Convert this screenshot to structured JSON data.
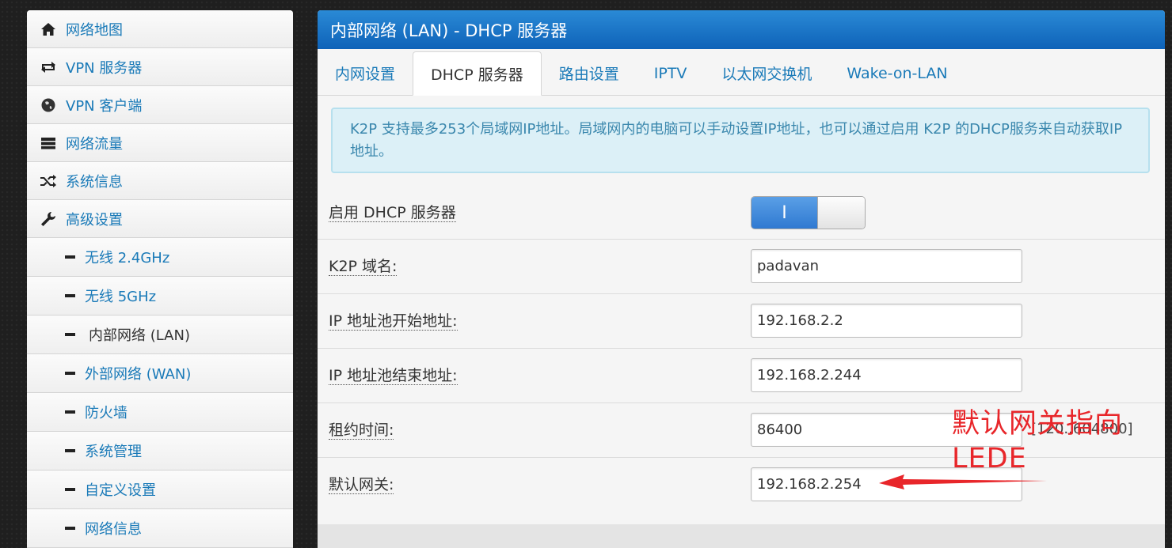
{
  "sidebar": {
    "items": [
      {
        "label": "网络地图",
        "icon": "home-icon"
      },
      {
        "label": "VPN 服务器",
        "icon": "retweet-icon"
      },
      {
        "label": "VPN 客户端",
        "icon": "globe-icon"
      },
      {
        "label": "网络流量",
        "icon": "tasks-icon"
      },
      {
        "label": "系统信息",
        "icon": "random-icon"
      },
      {
        "label": "高级设置",
        "icon": "wrench-icon"
      }
    ],
    "subitems": [
      {
        "label": "无线 2.4GHz"
      },
      {
        "label": "无线 5GHz"
      },
      {
        "label": "内部网络 (LAN)",
        "active": true
      },
      {
        "label": "外部网络 (WAN)"
      },
      {
        "label": "防火墙"
      },
      {
        "label": "系统管理"
      },
      {
        "label": "自定义设置"
      },
      {
        "label": "网络信息"
      }
    ]
  },
  "main": {
    "title": "内部网络 (LAN) - DHCP 服务器",
    "tabs": [
      {
        "label": "内网设置"
      },
      {
        "label": "DHCP 服务器",
        "active": true
      },
      {
        "label": "路由设置"
      },
      {
        "label": "IPTV"
      },
      {
        "label": "以太网交换机"
      },
      {
        "label": "Wake-on-LAN"
      }
    ],
    "info": "K2P 支持最多253个局域网IP地址。局域网内的电脑可以手动设置IP地址，也可以通过启用 K2P 的DHCP服务来自动获取IP地址。",
    "fields": {
      "dhcp_enable": {
        "label": "启用 DHCP 服务器",
        "state": "on",
        "on_text": "I"
      },
      "domain": {
        "label": "K2P 域名:",
        "value": "padavan"
      },
      "pool_start": {
        "label": "IP 地址池开始地址:",
        "value": "192.168.2.2"
      },
      "pool_end": {
        "label": "IP 地址池结束地址:",
        "value": "192.168.2.244"
      },
      "lease": {
        "label": "租约时间:",
        "value": "86400",
        "hint": "[120..604800]"
      },
      "gateway": {
        "label": "默认网关:",
        "value": "192.168.2.254"
      }
    }
  },
  "annotation": {
    "line1": "默认网关指向",
    "line2": "LEDE",
    "color": "#e8262a"
  },
  "colors": {
    "accent": "#1a7ab8",
    "title_bar": "#1a72c4",
    "info_bg": "#dcf0f7"
  }
}
